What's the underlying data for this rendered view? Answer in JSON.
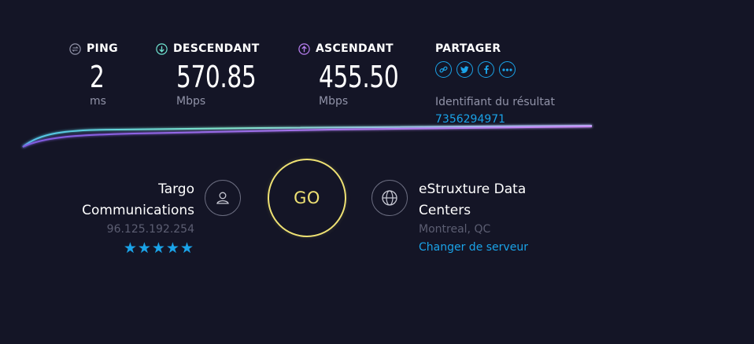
{
  "colors": {
    "background": "#141526",
    "accent_blue": "#1aa3e8",
    "go_yellow": "#eee173",
    "download_teal": "#6fe3d0",
    "upload_purple": "#b77ef0",
    "muted_text": "#9193a8"
  },
  "metrics": {
    "ping": {
      "label": "PING",
      "value": "2",
      "unit": "ms",
      "icon": "ping-icon"
    },
    "download": {
      "label": "DESCENDANT",
      "value": "570.85",
      "unit": "Mbps",
      "icon": "download-arrow-icon"
    },
    "upload": {
      "label": "ASCENDANT",
      "value": "455.50",
      "unit": "Mbps",
      "icon": "upload-arrow-icon"
    }
  },
  "share": {
    "label": "PARTAGER",
    "icons": [
      "link-icon",
      "twitter-icon",
      "facebook-icon",
      "more-icon"
    ],
    "result_label": "Identifiant du résultat",
    "result_id": "7356294971"
  },
  "isp": {
    "name_line1": "Targo",
    "name_line2": "Communications",
    "ip": "96.125.192.254",
    "rating": 5,
    "stars": "★★★★★",
    "icon": "user-icon"
  },
  "go": {
    "label": "GO"
  },
  "server": {
    "name_line1": "eStruxture Data",
    "name_line2": "Centers",
    "location": "Montreal, QC",
    "change_label": "Changer de serveur",
    "icon": "globe-icon"
  }
}
